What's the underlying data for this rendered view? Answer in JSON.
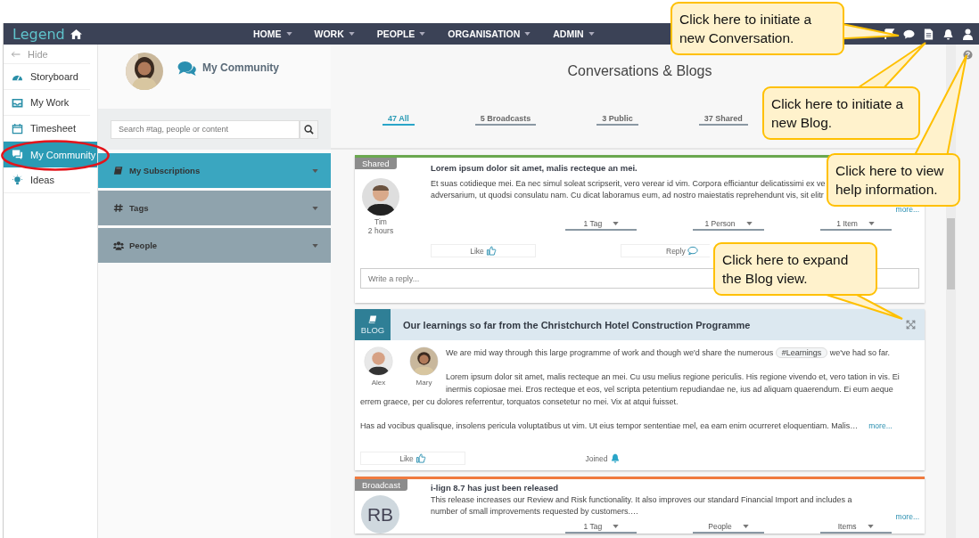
{
  "nav": {
    "logo": "Legend",
    "items": [
      {
        "label": "HOME"
      },
      {
        "label": "WORK"
      },
      {
        "label": "PEOPLE"
      },
      {
        "label": "ORGANISATION"
      },
      {
        "label": "ADMIN"
      }
    ]
  },
  "sidebar": {
    "hide": "Hide",
    "items": [
      {
        "label": "Storyboard",
        "selected": false
      },
      {
        "label": "My Work",
        "selected": false
      },
      {
        "label": "Timesheet",
        "selected": false
      },
      {
        "label": "My Community",
        "selected": true
      },
      {
        "label": "Ideas",
        "selected": false
      }
    ]
  },
  "community": {
    "title": "My Community",
    "search": {
      "placeholder": "Search #tag, people or content"
    },
    "sections": [
      {
        "label": "My Subscriptions",
        "selected": true
      },
      {
        "label": "Tags",
        "selected": false
      },
      {
        "label": "People",
        "selected": false
      }
    ]
  },
  "main": {
    "title": "Conversations & Blogs",
    "tabs": [
      {
        "label": "47 All",
        "selected": true
      },
      {
        "label": "5 Broadcasts",
        "selected": false
      },
      {
        "label": "3 Public",
        "selected": false
      },
      {
        "label": "37 Shared",
        "selected": false
      }
    ],
    "posts": [
      {
        "kind": "shared",
        "label": "Shared",
        "author": "Tim",
        "time": "2 hours",
        "title": "Lorem ipsum dolor sit amet, malis recteque an mei.",
        "lines": [
          "Et suas cotidieque mei. Ea nec simul soleat scripserit, vero verear id vim. Corpora efficiantur delicatissimi ex ve",
          "adversarium, ut quodsi consulatu nam. Cu dicat laboramus eum, ad nostro maiestatis reprehendunt vis, sit elitr"
        ],
        "more": "more...",
        "filters": [
          "1 Tag",
          "1 Person",
          "1 Item"
        ],
        "actions": [
          "Like",
          "Reply"
        ],
        "reply_placeholder": "Write a reply..."
      },
      {
        "kind": "blog",
        "label": "BLOG",
        "title": "Our learnings so far from the Christchurch Hotel Construction Programme",
        "authors": [
          "Alex",
          "Mary"
        ],
        "intro": {
          "before": "We are mid way through this large programme of work and though we'd share the numerous",
          "tag": "#Learnings",
          "after": "we've had so far."
        },
        "text_beside": "Lorem ipsum dolor sit amet, malis recteque an mei. Cu usu melius regione periculis. His regione vivendo et, vero tation in vis. Ei inermis copiosae mei. Eros recteque et eos, vel scripta petentium repudiandae ne, ius ad aliquam quaerendum. Ei eum aeque",
        "text_below": [
          "errem graece, per cu dolores referrentur, torquatos consetetur no mei. Vix at atqui fuisset.",
          "Has ad vocibus qualisque, insolens pericula voluptatibus ut vim. Ut eius tempor sententiae mel, ea eam enim ocurreret eloquentiam. Malis…"
        ],
        "more": "more...",
        "actions": [
          "Like",
          "Joined"
        ]
      },
      {
        "kind": "broadcast",
        "label": "Broadcast",
        "initials": "RB",
        "title": "i-lign 8.7 has just been released",
        "lines": [
          "This release increases our Review and Risk functionality. It also improves our standard Financial Import and includes a number of small improvements requested by customers.…"
        ],
        "more": "more...",
        "filters": [
          "1 Tag",
          "People",
          "Items"
        ]
      }
    ]
  },
  "callouts": [
    {
      "text": "Click here to initiate a new Conversation."
    },
    {
      "text": "Click here to initiate a new Blog."
    },
    {
      "text": "Click here to view help information."
    },
    {
      "text": "Click here to expand the Blog view."
    }
  ]
}
